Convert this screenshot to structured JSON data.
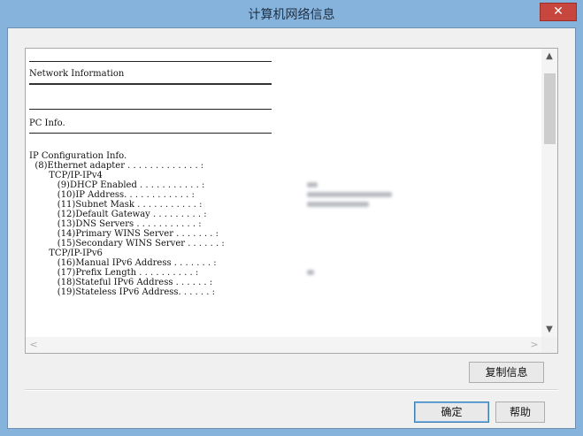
{
  "window": {
    "title": "计算机网络信息",
    "close_label": "✕"
  },
  "info": {
    "network_heading": "Network Information",
    "pc_heading": "PC Info.",
    "lines": [
      "IP Configuration Info.",
      "  (8)Ethernet adapter . . . . . . . . . . . . . :",
      "       TCP/IP-IPv4",
      "          (9)DHCP Enabled . . . . . . . . . . . :",
      "          (10)IP Address. . . . . . . . . . . . :",
      "          (11)Subnet Mask . . . . . . . . . . . :",
      "          (12)Default Gateway . . . . . . . . . :",
      "          (13)DNS Servers . . . . . . . . . . . :",
      "          (14)Primary WINS Server . . . . . . . :",
      "          (15)Secondary WINS Server . . . . . . :",
      "       TCP/IP-IPv6",
      "          (16)Manual IPv6 Address . . . . . . . :",
      "          (17)Prefix Length . . . . . . . . . . :",
      "          (18)Stateful IPv6 Address . . . . . . :",
      "          (19)Stateless IPv6 Address. . . . . . :"
    ]
  },
  "scroll": {
    "up": "▲",
    "down": "▼",
    "left": "<",
    "right": ">"
  },
  "buttons": {
    "copy": "复制信息",
    "ok": "确定",
    "help": "帮助"
  }
}
